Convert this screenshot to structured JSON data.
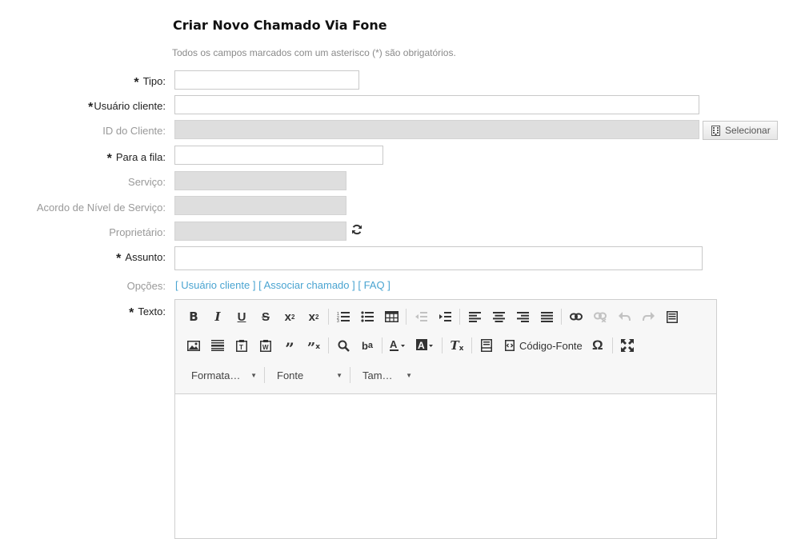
{
  "page": {
    "title": "Criar Novo Chamado Via Fone",
    "subtitle": "Todos os campos marcados com um asterisco (*) são obrigatórios."
  },
  "form": {
    "tipo": {
      "label": "Tipo:",
      "value": ""
    },
    "usuario_cliente": {
      "label": "Usuário cliente:",
      "value": ""
    },
    "id_cliente": {
      "label": "ID do Cliente:",
      "value": "",
      "button": "Selecionar"
    },
    "para_fila": {
      "label": "Para a fila:",
      "value": ""
    },
    "servico": {
      "label": "Serviço:",
      "value": ""
    },
    "acordo": {
      "label": "Acordo de Nível de Serviço:",
      "value": ""
    },
    "proprietario": {
      "label": "Proprietário:",
      "value": ""
    },
    "assunto": {
      "label": "Assunto:",
      "value": ""
    },
    "opcoes": {
      "label": "Opções:",
      "links": [
        "[ Usuário cliente ]",
        "[ Associar chamado ]",
        "[ FAQ ]"
      ]
    },
    "texto": {
      "label": "Texto:"
    }
  },
  "editor": {
    "source_label": "Código-Fonte",
    "format_combo": "Formata…",
    "font_combo": "Fonte",
    "size_combo": "Tam…",
    "content": ""
  },
  "colors": {
    "link": "#4aa4d1",
    "disabled_field": "#dedede",
    "toolbar_bg": "#f7f7f7"
  }
}
